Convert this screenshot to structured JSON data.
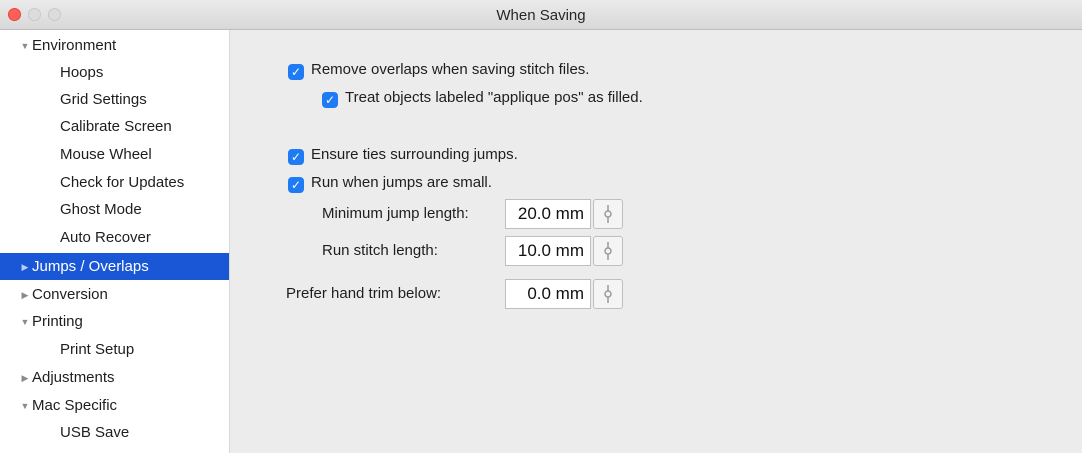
{
  "window": {
    "title": "When Saving"
  },
  "sidebar": {
    "items": [
      {
        "label": "Environment",
        "expander": "▼"
      },
      {
        "label": "Hoops"
      },
      {
        "label": "Grid Settings"
      },
      {
        "label": "Calibrate Screen"
      },
      {
        "label": "Mouse Wheel"
      },
      {
        "label": "Check for Updates"
      },
      {
        "label": "Ghost Mode"
      },
      {
        "label": "Auto Recover"
      },
      {
        "label": "Jumps / Overlaps",
        "expander": "▶",
        "selected": true
      },
      {
        "label": "Conversion",
        "expander": "▶"
      },
      {
        "label": "Printing",
        "expander": "▼"
      },
      {
        "label": "Print Setup"
      },
      {
        "label": "Adjustments",
        "expander": "▶"
      },
      {
        "label": "Mac Specific",
        "expander": "▼"
      },
      {
        "label": "USB Save"
      }
    ]
  },
  "options": {
    "remove_overlaps": {
      "label": "Remove overlaps when saving stitch files.",
      "checked": true
    },
    "treat_applique": {
      "label": "Treat objects labeled \"applique pos\" as filled.",
      "checked": true
    },
    "ensure_ties": {
      "label": "Ensure ties surrounding jumps.",
      "checked": true
    },
    "run_small_jumps": {
      "label": "Run when jumps are small.",
      "checked": true
    }
  },
  "fields": {
    "min_jump_length": {
      "label": "Minimum jump length:",
      "value": "20.0 mm"
    },
    "run_stitch_length": {
      "label": "Run stitch length:",
      "value": "10.0 mm"
    },
    "hand_trim_below": {
      "label": "Prefer hand trim below:",
      "value": "0.0 mm"
    }
  },
  "icons": {
    "checkmark": "✓",
    "stepper": "stepper-icon"
  },
  "colors": {
    "selection": "#1a57d6",
    "checkbox": "#1f7bf4",
    "close_button": "#ff5f57"
  }
}
